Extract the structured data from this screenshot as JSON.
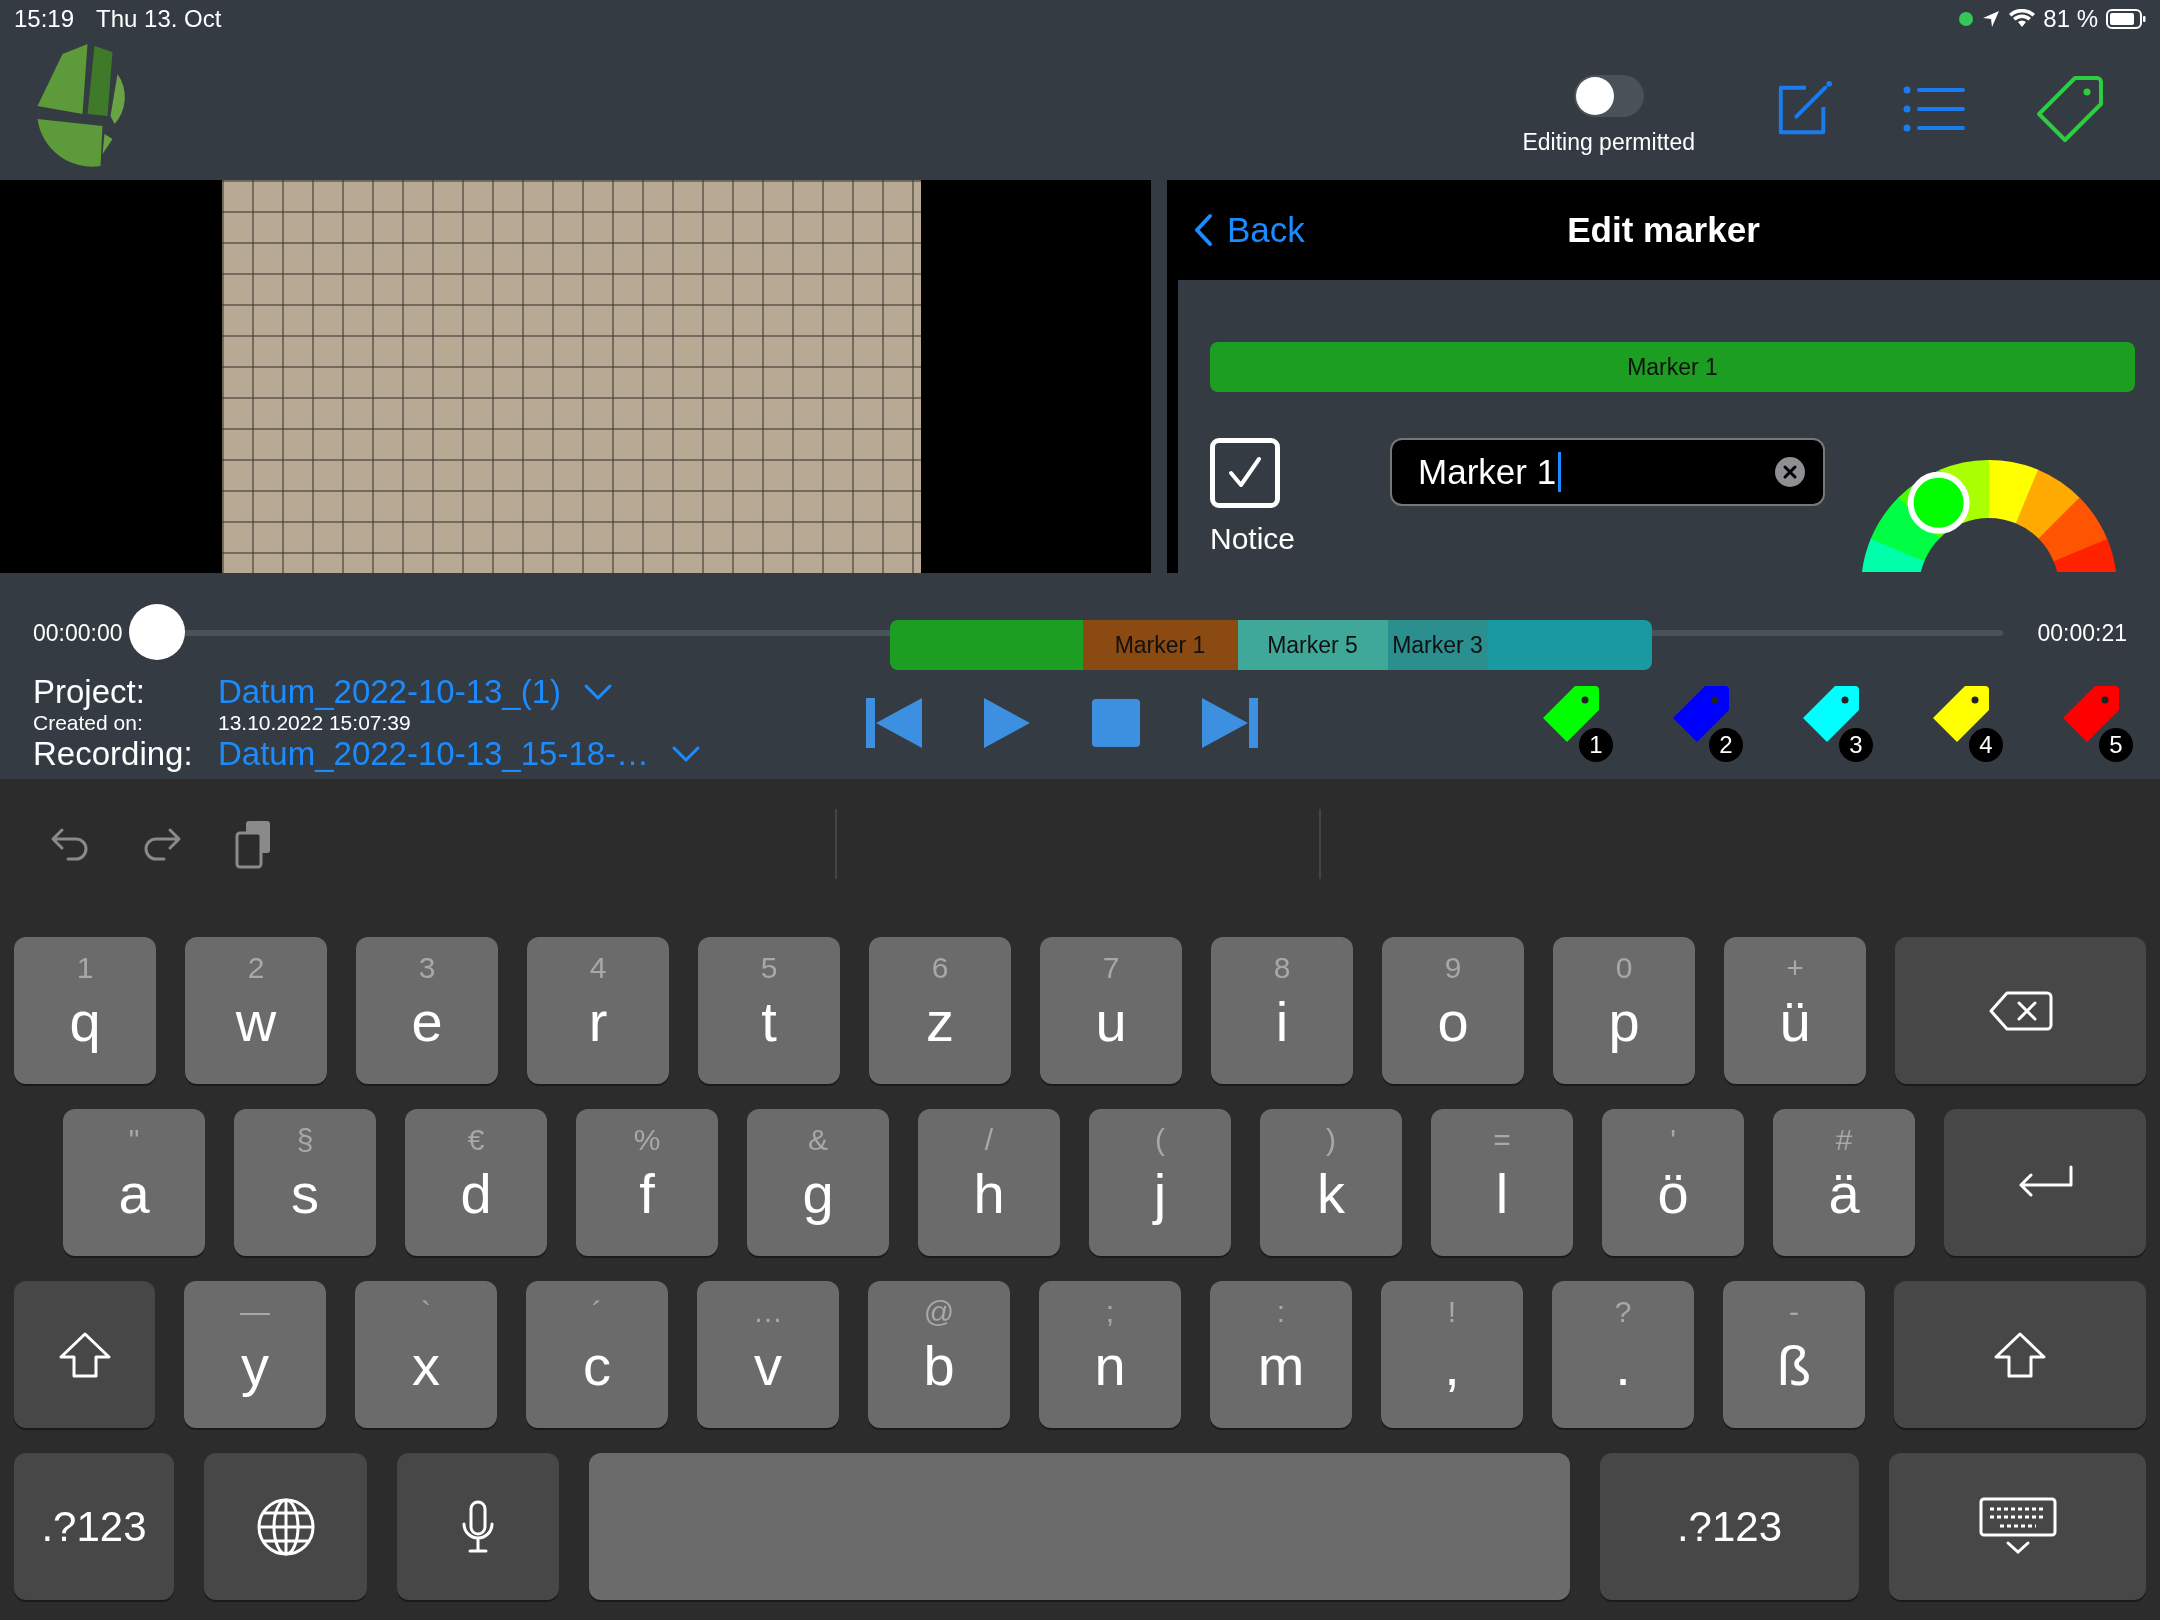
{
  "status_bar": {
    "time": "15:19",
    "date": "Thu 13. Oct",
    "battery": "81 %"
  },
  "toolbar": {
    "toggle": {
      "label": "Editing permitted",
      "on": false
    }
  },
  "editor": {
    "back": "Back",
    "title": "Edit marker",
    "banner": {
      "label": "Marker 1",
      "color": "#1c9e22"
    },
    "notice": {
      "label": "Notice",
      "checked": true
    },
    "name_field": {
      "value": "Marker 1"
    },
    "color_wheel": {
      "level": 0.33
    }
  },
  "timeline": {
    "start": "00:00:00",
    "end": "00:00:21",
    "position": {
      "level": 0
    },
    "segments": [
      {
        "color": "#1c9e22"
      },
      {
        "label": "Marker 1",
        "color": "#8a4a12"
      },
      {
        "label": "Marker 5",
        "color": "#3fa898"
      },
      {
        "label": "Marker 3",
        "color": "#2b8f90"
      },
      {
        "color": "#1a9aa0"
      }
    ]
  },
  "info": {
    "project_label": "Project:",
    "project": "Datum_2022-10-13_(1)",
    "created_label": "Created on:",
    "created": "13.10.2022 15:07:39",
    "recording_label": "Recording:",
    "recording": "Datum_2022-10-13_15-18-…"
  },
  "tags": [
    {
      "number": "1",
      "color": "#00ff00"
    },
    {
      "number": "2",
      "color": "#0000ff"
    },
    {
      "number": "3",
      "color": "#00ffff"
    },
    {
      "number": "4",
      "color": "#ffff00"
    },
    {
      "number": "5",
      "color": "#ff0000"
    }
  ],
  "keyboard": {
    "rows": [
      [
        {
          "kind": "letter",
          "alt": "1",
          "main": "q"
        },
        {
          "kind": "letter",
          "alt": "2",
          "main": "w"
        },
        {
          "kind": "letter",
          "alt": "3",
          "main": "e"
        },
        {
          "kind": "letter",
          "alt": "4",
          "main": "r"
        },
        {
          "kind": "letter",
          "alt": "5",
          "main": "t"
        },
        {
          "kind": "letter",
          "alt": "6",
          "main": "z"
        },
        {
          "kind": "letter",
          "alt": "7",
          "main": "u"
        },
        {
          "kind": "letter",
          "alt": "8",
          "main": "i"
        },
        {
          "kind": "letter",
          "alt": "9",
          "main": "o"
        },
        {
          "kind": "letter",
          "alt": "0",
          "main": "p"
        },
        {
          "kind": "letter",
          "alt": "+",
          "main": "ü"
        },
        {
          "kind": "backspace"
        }
      ],
      [
        {
          "kind": "letter",
          "alt": "\"",
          "main": "a"
        },
        {
          "kind": "letter",
          "alt": "§",
          "main": "s"
        },
        {
          "kind": "letter",
          "alt": "€",
          "main": "d"
        },
        {
          "kind": "letter",
          "alt": "%",
          "main": "f"
        },
        {
          "kind": "letter",
          "alt": "&",
          "main": "g"
        },
        {
          "kind": "letter",
          "alt": "/",
          "main": "h"
        },
        {
          "kind": "letter",
          "alt": "(",
          "main": "j"
        },
        {
          "kind": "letter",
          "alt": ")",
          "main": "k"
        },
        {
          "kind": "letter",
          "alt": "=",
          "main": "l"
        },
        {
          "kind": "letter",
          "alt": "'",
          "main": "ö"
        },
        {
          "kind": "letter",
          "alt": "#",
          "main": "ä"
        },
        {
          "kind": "return"
        }
      ],
      [
        {
          "kind": "shift"
        },
        {
          "kind": "letter",
          "alt": "—",
          "main": "y"
        },
        {
          "kind": "letter",
          "alt": "`",
          "main": "x"
        },
        {
          "kind": "letter",
          "alt": "´",
          "main": "c"
        },
        {
          "kind": "letter",
          "alt": "…",
          "main": "v"
        },
        {
          "kind": "letter",
          "alt": "@",
          "main": "b"
        },
        {
          "kind": "letter",
          "alt": ";",
          "main": "n"
        },
        {
          "kind": "letter",
          "alt": ":",
          "main": "m"
        },
        {
          "kind": "letter",
          "alt": "!",
          "main": ","
        },
        {
          "kind": "letter",
          "alt": "?",
          "main": "."
        },
        {
          "kind": "letter",
          "alt": "-",
          "main": "ß"
        },
        {
          "kind": "shift"
        }
      ],
      [
        {
          "kind": "mode",
          "main": ".?123"
        },
        {
          "kind": "globe"
        },
        {
          "kind": "mic"
        },
        {
          "kind": "space"
        },
        {
          "kind": "mode",
          "main": ".?123"
        },
        {
          "kind": "hide"
        }
      ]
    ]
  }
}
